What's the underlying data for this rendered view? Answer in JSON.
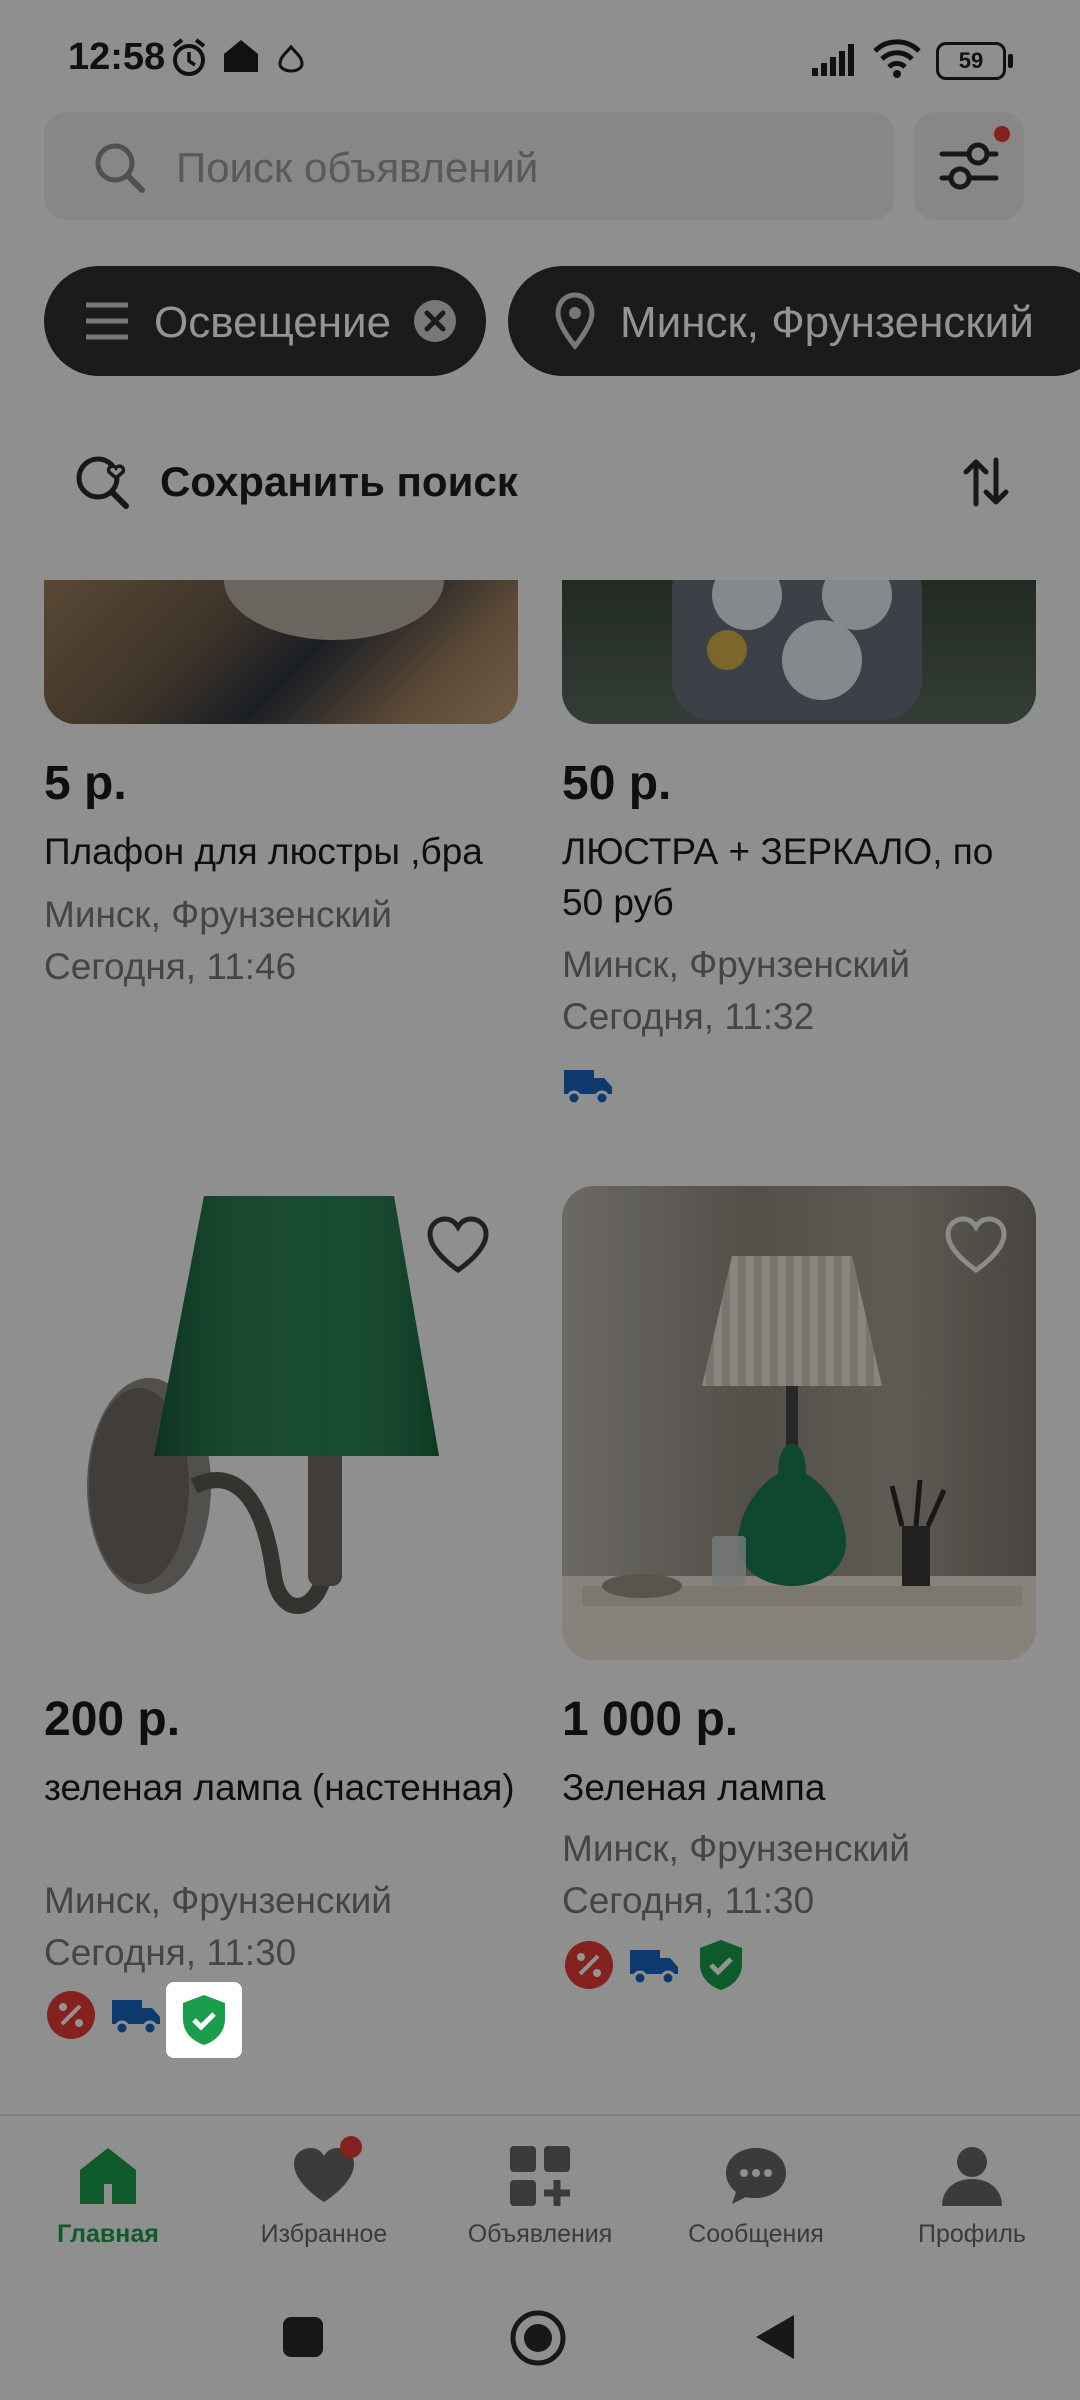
{
  "status_bar": {
    "time": "12:58",
    "battery": "59"
  },
  "search": {
    "placeholder": "Поиск объявлений"
  },
  "chips": [
    {
      "label": "Освещение"
    },
    {
      "label": "Минск, Фрунзенский"
    }
  ],
  "save_search": {
    "label": "Сохранить поиск"
  },
  "listings": [
    {
      "price": "5 р.",
      "title": "Плафон для люстры ,бра",
      "location": "Минск, Фрунзенский",
      "date": "Сегодня, 11:46",
      "badges": []
    },
    {
      "price": "50 р.",
      "title": "ЛЮСТРА + ЗЕРКАЛО, по 50 руб",
      "location": "Минск, Фрунзенский",
      "date": "Сегодня, 11:32",
      "badges": [
        "delivery-icon"
      ]
    },
    {
      "price": "200 р.",
      "title": "зеленая лампа (настенная)",
      "location": "Минск, Фрунзенский",
      "date": "Сегодня, 11:30",
      "badges": [
        "discount-icon",
        "delivery-icon",
        "verified-shield-icon"
      ]
    },
    {
      "price": "1 000 р.",
      "title": "Зеленая лампа",
      "location": "Минск, Фрунзенский",
      "date": "Сегодня, 11:30",
      "badges": [
        "discount-icon",
        "delivery-icon",
        "verified-shield-icon"
      ]
    }
  ],
  "nav": [
    {
      "label": "Главная",
      "icon": "home-icon",
      "active": true
    },
    {
      "label": "Избранное",
      "icon": "heart-icon"
    },
    {
      "label": "Объявления",
      "icon": "ads-grid-icon"
    },
    {
      "label": "Сообщения",
      "icon": "chat-icon"
    },
    {
      "label": "Профиль",
      "icon": "profile-icon"
    }
  ],
  "colors": {
    "accent_green": "#1b9e4b",
    "badge_red": "#e53935",
    "badge_blue": "#1565c0",
    "chip_dark": "#2f2f2f"
  }
}
